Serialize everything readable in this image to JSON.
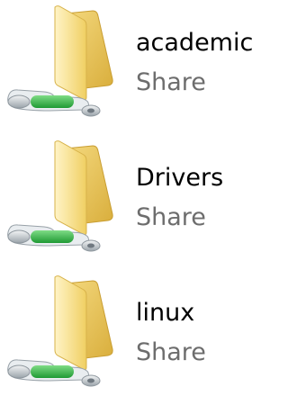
{
  "shares": [
    {
      "name": "academic",
      "type": "Share",
      "icon": "network-shared-folder-icon"
    },
    {
      "name": "Drivers",
      "type": "Share",
      "icon": "network-shared-folder-icon"
    },
    {
      "name": "linux",
      "type": "Share",
      "icon": "network-shared-folder-icon"
    }
  ],
  "colors": {
    "folder_light": "#fbe9a6",
    "folder_mid": "#f2d36d",
    "folder_dark": "#d9ae3c",
    "pipe_green": "#38b84a",
    "pipe_metal": "#c8cfd4",
    "share_type_text": "#6d6d6d"
  }
}
